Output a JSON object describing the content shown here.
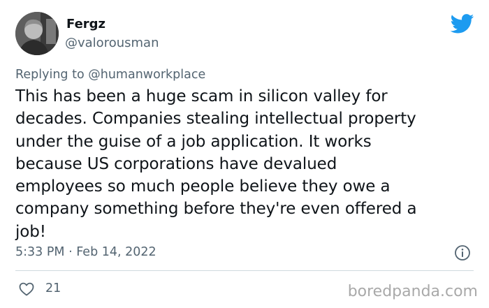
{
  "author": {
    "name": "Fergz",
    "handle": "@valorousman"
  },
  "reply": {
    "prefix": "Replying to",
    "mention": "@humanworkplace"
  },
  "tweet": {
    "lines": [
      "This has been a huge scam in silicon valley for",
      "decades. Companies stealing intellectual property",
      "under the guise of a job application. It works",
      "because US corporations have devalued",
      "employees so much people believe they owe a",
      "company something before they're even offered a",
      "job!"
    ],
    "timestamp": "5:33 PM · Feb 14, 2022"
  },
  "actions": {
    "like_count": "21"
  },
  "watermark": "boredpanda.com",
  "icons": {
    "brand": "twitter-bird-icon",
    "info": "info-icon",
    "like": "heart-icon"
  },
  "colors": {
    "twitter_blue": "#1d9bf0",
    "secondary_text": "#536471",
    "divider": "#cfd9de",
    "watermark": "#a9a9a9"
  }
}
